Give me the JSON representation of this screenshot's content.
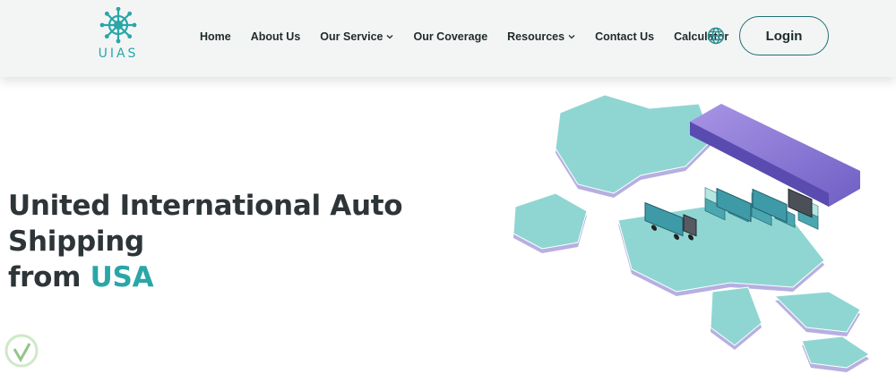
{
  "brand": {
    "logo_text": "UIAS",
    "accent": "#2aa6a8"
  },
  "nav": {
    "items": [
      {
        "label": "Home",
        "has_dropdown": false
      },
      {
        "label": "About Us",
        "has_dropdown": false
      },
      {
        "label": "Our Service",
        "has_dropdown": true
      },
      {
        "label": "Our Coverage",
        "has_dropdown": false
      },
      {
        "label": "Resources",
        "has_dropdown": true
      },
      {
        "label": "Contact Us",
        "has_dropdown": false
      },
      {
        "label": "Calculator",
        "has_dropdown": false
      }
    ],
    "language_icon": "globe-icon",
    "login_label": "Login"
  },
  "hero": {
    "title_line1": "United International Auto Shipping",
    "title_prefix": "from ",
    "title_accent": "USA"
  },
  "colors": {
    "header_bg": "#f3f5f5",
    "text_dark": "#2e3538",
    "map_teal": "#8fd6d2",
    "ship_purple": "#8c7bd6"
  }
}
